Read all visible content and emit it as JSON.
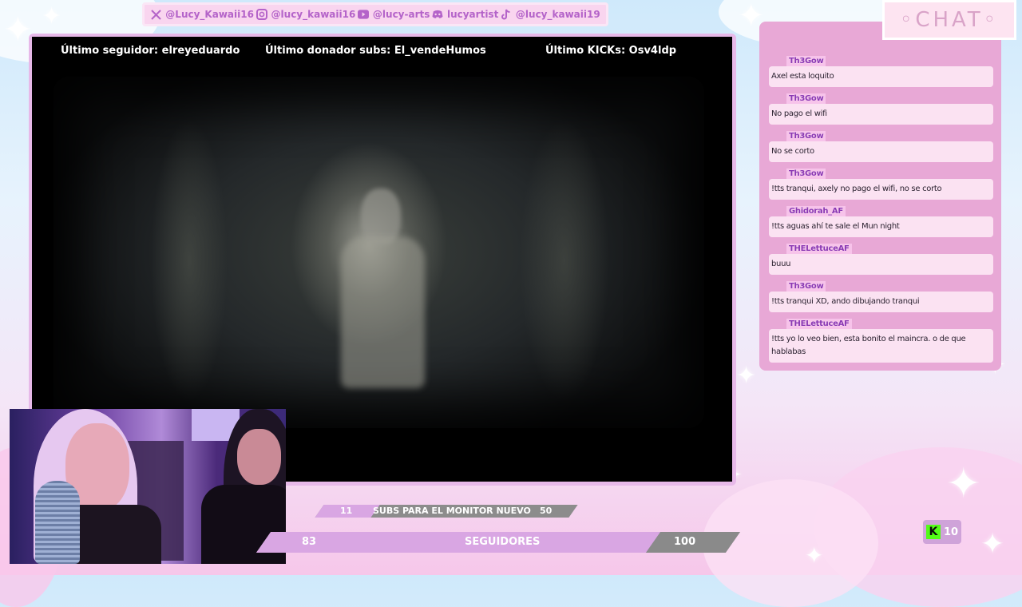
{
  "social": [
    {
      "icon": "x-icon",
      "label": "@Lucy_Kawaii16"
    },
    {
      "icon": "instagram-icon",
      "label": "@lucy_kawaii16"
    },
    {
      "icon": "youtube-icon",
      "label": "@lucy-arts"
    },
    {
      "icon": "discord-icon",
      "label": "lucyartist"
    },
    {
      "icon": "tiktok-icon",
      "label": "@lucy_kawaii19"
    }
  ],
  "alerts": {
    "follower": "Último seguidor: elreyeduardo",
    "donor": "Último donador subs: El_vendeHumos",
    "kicks": "Último KICKs: Osv4ldp"
  },
  "goals": {
    "subs": {
      "current": "11",
      "label": "SUBS PARA EL MONITOR NUEVO",
      "target": "50",
      "progress": 0.22
    },
    "followers": {
      "current": "83",
      "label": "SEGUIDORES",
      "target": "100",
      "progress": 0.83
    }
  },
  "chat": {
    "title": "◦CHAT◦",
    "messages": [
      {
        "user": "Th3Gow",
        "text": "Axel esta loquito"
      },
      {
        "user": "Th3Gow",
        "text": "No pago el wifi"
      },
      {
        "user": "Th3Gow",
        "text": "No se corto"
      },
      {
        "user": "Th3Gow",
        "text": "!tts tranqui, axely no pago el wifi, no se corto"
      },
      {
        "user": "Ghidorah_AF",
        "text": "!tts aguas ahí te sale el Mun night"
      },
      {
        "user": "THELettuceAF",
        "text": "buuu"
      },
      {
        "user": "Th3Gow",
        "text": "!tts tranqui XD, ando dibujando tranqui"
      },
      {
        "user": "THELettuceAF",
        "text": "!tts yo lo veo bien, esta bonito el maincra. o de que hablabas"
      }
    ]
  },
  "kick": {
    "count": "10",
    "icon": "kick-icon"
  },
  "colors": {
    "accent": "#d9a6e3",
    "chat_panel": "#e8a8d6",
    "kick": "#53fc18"
  }
}
